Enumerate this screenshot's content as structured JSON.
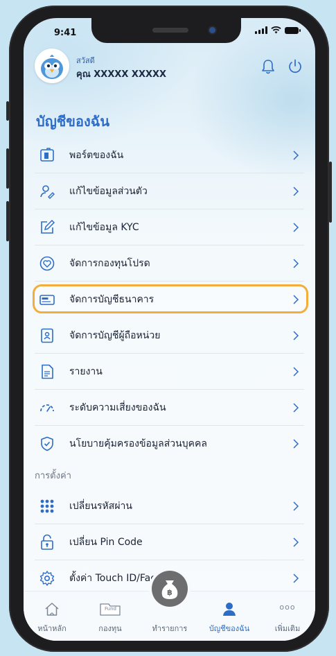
{
  "status": {
    "time": "9:41"
  },
  "header": {
    "greeting": "สวัสดี",
    "username": "คุณ XXXXX XXXXX"
  },
  "page_title": "บัญชีของฉัน",
  "menu_items": [
    {
      "label": "พอร์ตของฉัน",
      "icon": "portfolio-icon"
    },
    {
      "label": "แก้ไขข้อมูลส่วนตัว",
      "icon": "user-edit-icon"
    },
    {
      "label": "แก้ไขข้อมูล KYC",
      "icon": "edit-icon"
    },
    {
      "label": "จัดการกองทุนโปรด",
      "icon": "heart-icon"
    },
    {
      "label": "จัดการบัญชีธนาคาร",
      "icon": "bank-card-icon",
      "highlighted": true
    },
    {
      "label": "จัดการบัญชีผู้ถือหน่วย",
      "icon": "unitholder-icon"
    },
    {
      "label": "รายงาน",
      "icon": "report-icon"
    },
    {
      "label": "ระดับความเสี่ยงของฉัน",
      "icon": "risk-gauge-icon"
    },
    {
      "label": "นโยบายคุ้มครองข้อมูลส่วนบุคคล",
      "icon": "shield-check-icon"
    }
  ],
  "settings_section": "การตั้งค่า",
  "settings_items": [
    {
      "label": "เปลี่ยนรหัสผ่าน",
      "icon": "keypad-icon"
    },
    {
      "label": "เปลี่ยน Pin Code",
      "icon": "lock-icon"
    },
    {
      "label": "ตั้งค่า Touch ID/Face ID",
      "icon": "gear-icon"
    }
  ],
  "tabs": [
    {
      "label": "หน้าหลัก",
      "icon": "home-icon"
    },
    {
      "label": "กองทุน",
      "icon": "fund-icon",
      "icon_text": "Fund"
    },
    {
      "label": "ทำรายการ",
      "icon": "money-bag-icon",
      "icon_text": "฿"
    },
    {
      "label": "บัญชีของฉัน",
      "icon": "person-icon",
      "active": true
    },
    {
      "label": "เพิ่มเติม",
      "icon": "more-icon",
      "icon_text": "ooo"
    }
  ],
  "colors": {
    "primary": "#2d6cc7",
    "highlight": "#f2ad3a",
    "text": "#1a2233"
  }
}
